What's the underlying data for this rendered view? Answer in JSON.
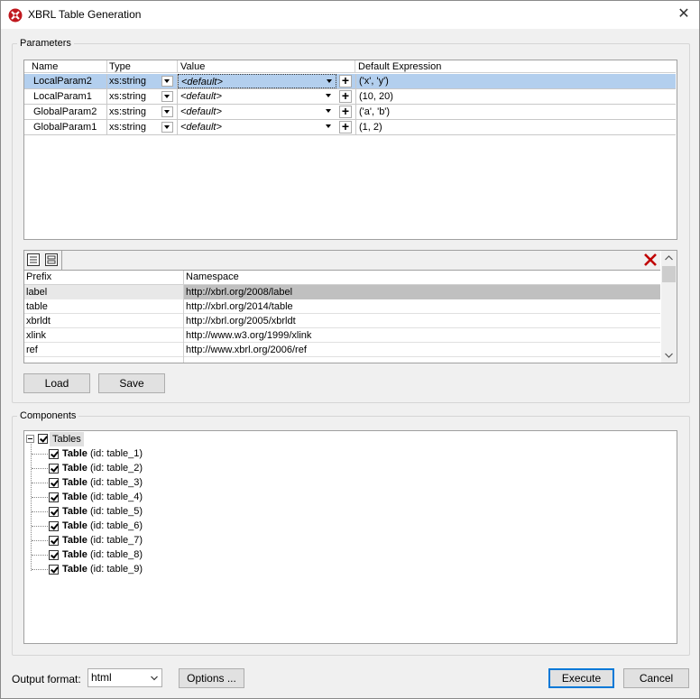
{
  "window": {
    "title": "XBRL Table Generation"
  },
  "parameters": {
    "group_label": "Parameters",
    "columns": [
      "Name",
      "Type",
      "Value",
      "Default Expression"
    ],
    "rows": [
      {
        "name": "LocalParam2",
        "type": "xs:string",
        "value": "<default>",
        "default_expr": "('x', 'y')",
        "selected": true
      },
      {
        "name": "LocalParam1",
        "type": "xs:string",
        "value": "<default>",
        "default_expr": "(10, 20)",
        "selected": false
      },
      {
        "name": "GlobalParam2",
        "type": "xs:string",
        "value": "<default>",
        "default_expr": "('a', 'b')",
        "selected": false
      },
      {
        "name": "GlobalParam1",
        "type": "xs:string",
        "value": "<default>",
        "default_expr": "(1, 2)",
        "selected": false
      }
    ]
  },
  "ns": {
    "columns": [
      "Prefix",
      "Namespace"
    ],
    "rows": [
      {
        "prefix": "label",
        "uri": "http://xbrl.org/2008/label",
        "selected": true
      },
      {
        "prefix": "table",
        "uri": "http://xbrl.org/2014/table",
        "selected": false
      },
      {
        "prefix": "xbrldt",
        "uri": "http://xbrl.org/2005/xbrldt",
        "selected": false
      },
      {
        "prefix": "xlink",
        "uri": "http://www.w3.org/1999/xlink",
        "selected": false
      },
      {
        "prefix": "ref",
        "uri": "http://www.xbrl.org/2006/ref",
        "selected": false
      },
      {
        "prefix": "",
        "uri": "",
        "selected": false
      }
    ]
  },
  "buttons": {
    "load": "Load",
    "save": "Save",
    "options": "Options ...",
    "execute": "Execute",
    "cancel": "Cancel"
  },
  "components": {
    "group_label": "Components",
    "root": "Tables",
    "items": [
      {
        "bold": "Table",
        "rest": " (id: table_1)"
      },
      {
        "bold": "Table",
        "rest": " (id: table_2)"
      },
      {
        "bold": "Table",
        "rest": " (id: table_3)"
      },
      {
        "bold": "Table",
        "rest": " (id: table_4)"
      },
      {
        "bold": "Table",
        "rest": " (id: table_5)"
      },
      {
        "bold": "Table",
        "rest": " (id: table_6)"
      },
      {
        "bold": "Table",
        "rest": " (id: table_7)"
      },
      {
        "bold": "Table",
        "rest": " (id: table_8)"
      },
      {
        "bold": "Table",
        "rest": " (id: table_9)"
      }
    ]
  },
  "output": {
    "label": "Output format:",
    "value": "html"
  },
  "colors": {
    "selection": "#b3cfee",
    "ns_selection": "#c0c0c0",
    "delete_red": "#c00000",
    "app_icon_red": "#c0181e"
  }
}
